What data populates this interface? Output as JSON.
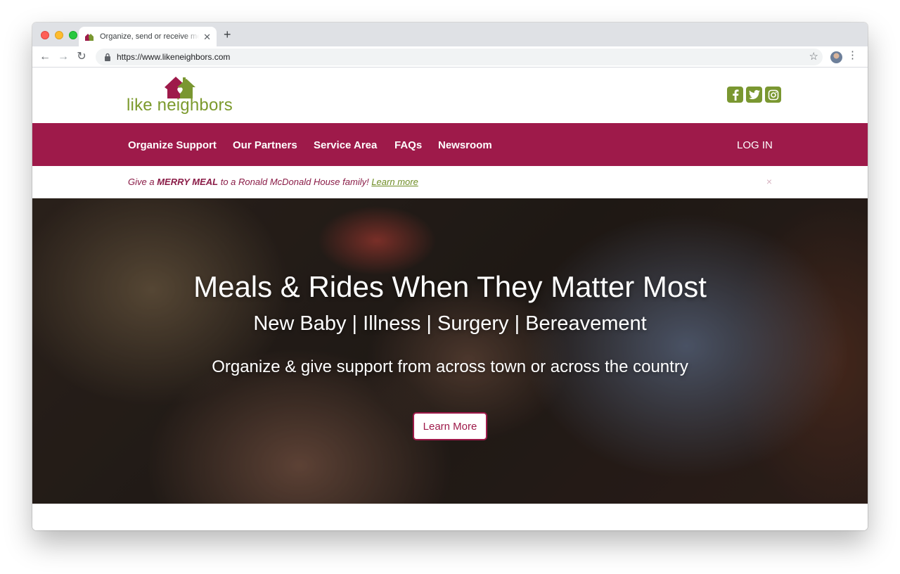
{
  "browser": {
    "tab_title": "Organize, send or receive meals",
    "url": "https://www.likeneighbors.com"
  },
  "site": {
    "logo_text": "like neighbors",
    "brand_colors": {
      "primary": "#9e1a4a",
      "accent": "#7a9731"
    },
    "social": [
      "facebook-icon",
      "twitter-icon",
      "instagram-icon"
    ]
  },
  "nav": {
    "items": [
      "Organize Support",
      "Our Partners",
      "Service Area",
      "FAQs",
      "Newsroom"
    ],
    "login": "LOG IN"
  },
  "banner": {
    "prefix": "Give a ",
    "highlight": "MERRY MEAL",
    "suffix": " to a Ronald McDonald House family! ",
    "link": "Learn more",
    "close": "×"
  },
  "hero": {
    "title": "Meals & Rides When They Matter Most",
    "subtitle": "New Baby | Illness | Surgery | Bereavement",
    "tagline": "Organize & give support from across town or across the country",
    "button": "Learn More"
  }
}
